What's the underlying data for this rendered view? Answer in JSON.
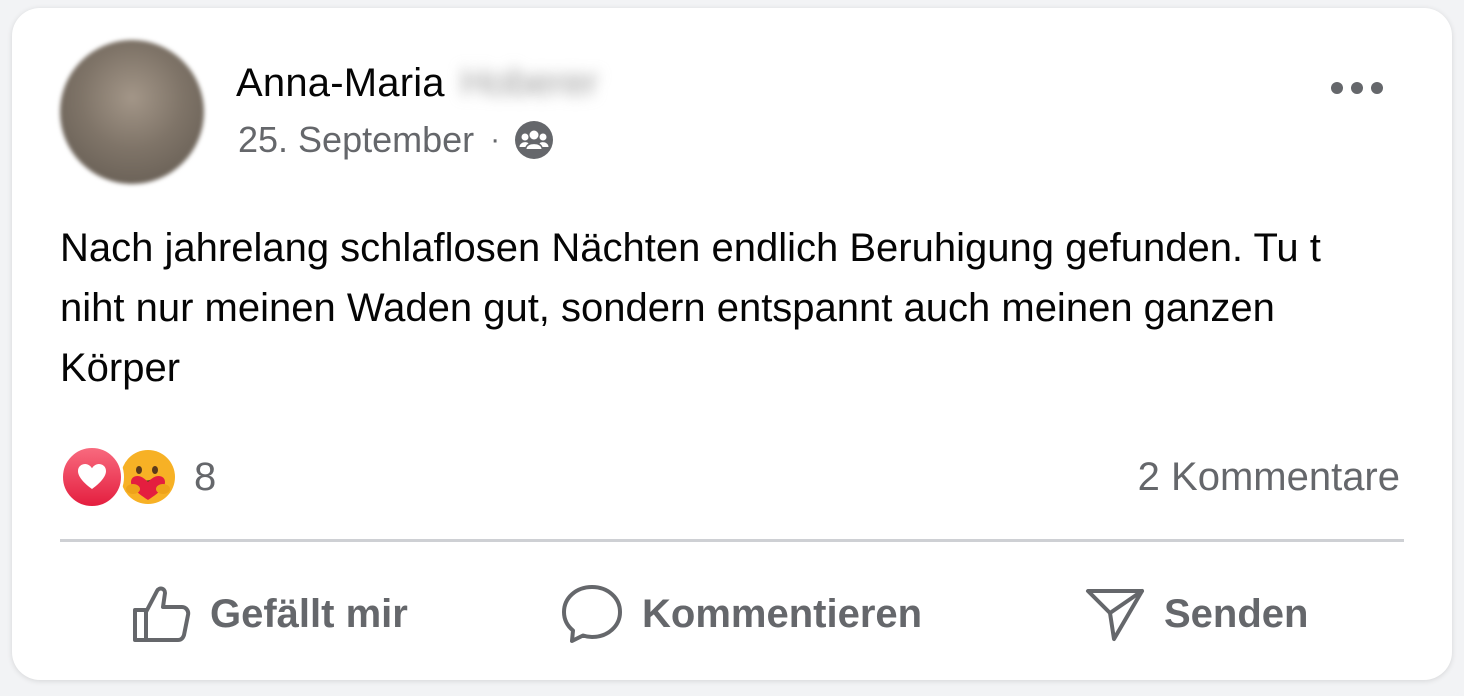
{
  "post": {
    "author_name": "Anna-Maria",
    "author_surname": "Hoberer",
    "date": "25. September",
    "separator": "·",
    "audience_icon": "friends-icon",
    "more_icon": "more-horizontal-icon",
    "text": "Nach jahrelang schlaflosen Nächten endlich Beruhigung gefunden. Tu t niht nur meinen Waden gut, sondern entspannt auch meinen ganzen Körper"
  },
  "reactions": {
    "types": [
      "love",
      "care"
    ],
    "count": "8",
    "comments_label": "2 Kommentare"
  },
  "actions": {
    "like_label": "Gefällt mir",
    "comment_label": "Kommentieren",
    "send_label": "Senden"
  },
  "colors": {
    "text_primary": "#050505",
    "text_secondary": "#65676b",
    "love_red": "#e41e3f",
    "care_yellow": "#f7b125",
    "divider": "#ced0d4"
  }
}
